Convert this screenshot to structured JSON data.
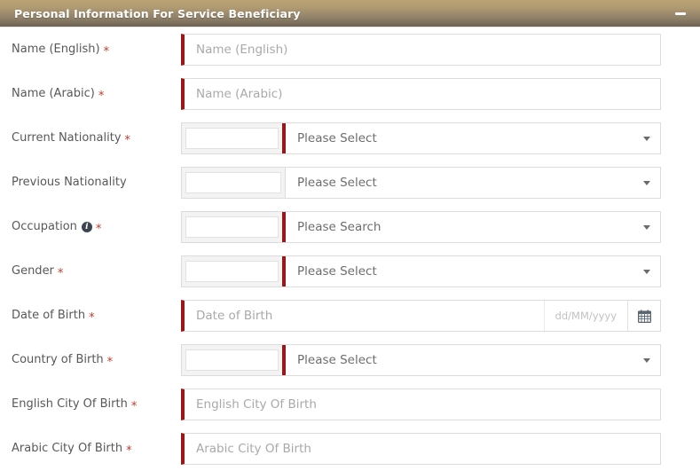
{
  "header": {
    "title": "Personal Information For Service Beneficiary",
    "minimize_icon": "minimize-icon",
    "minimize_label": "—",
    "gradient_top": "#bba273",
    "gradient_bottom": "#6d6254"
  },
  "theme": {
    "required_marker_color": "#c0392b",
    "required_border_color": "#9b1616",
    "label_color": "#585858",
    "placeholder_color": "#a9a9a9",
    "select_text_color": "#6d6d6d",
    "border_color": "#dcdcdc",
    "prefix_bg": "#f3f3f3"
  },
  "required_marker": "*",
  "rows": [
    {
      "id": "name-english",
      "label": "Name (English)",
      "required": true,
      "type": "text",
      "placeholder": "Name (English)",
      "value": ""
    },
    {
      "id": "name-arabic",
      "label": "Name (Arabic)",
      "required": true,
      "type": "text",
      "placeholder": "Name (Arabic)",
      "value": ""
    },
    {
      "id": "current-nationality",
      "label": "Current Nationality",
      "required": true,
      "type": "combo",
      "prefix_value": "",
      "selected": "Please Select",
      "caret_icon": "chevron-down-icon"
    },
    {
      "id": "previous-nationality",
      "label": "Previous Nationality",
      "required": false,
      "type": "combo",
      "prefix_value": "",
      "selected": "Please Select",
      "caret_icon": "chevron-down-icon"
    },
    {
      "id": "occupation",
      "label": "Occupation",
      "required": true,
      "info": true,
      "info_icon": "info-icon",
      "info_glyph": "i",
      "type": "combo",
      "prefix_value": "",
      "selected": "Please Search",
      "caret_icon": "chevron-down-icon"
    },
    {
      "id": "gender",
      "label": "Gender",
      "required": true,
      "type": "combo",
      "prefix_value": "",
      "selected": "Please Select",
      "caret_icon": "chevron-down-icon"
    },
    {
      "id": "date-of-birth",
      "label": "Date of Birth",
      "required": true,
      "type": "date",
      "placeholder": "Date of Birth",
      "value": "",
      "format_hint": "dd/MM/yyyy",
      "calendar_icon": "calendar-icon"
    },
    {
      "id": "country-of-birth",
      "label": "Country of Birth",
      "required": true,
      "type": "combo",
      "prefix_value": "",
      "selected": "Please Select",
      "caret_icon": "chevron-down-icon"
    },
    {
      "id": "english-city-of-birth",
      "label": "English City Of Birth",
      "required": true,
      "type": "text",
      "placeholder": "English City Of Birth",
      "value": ""
    },
    {
      "id": "arabic-city-of-birth",
      "label": "Arabic City Of Birth",
      "required": true,
      "type": "text",
      "placeholder": "Arabic City Of Birth",
      "value": ""
    }
  ]
}
